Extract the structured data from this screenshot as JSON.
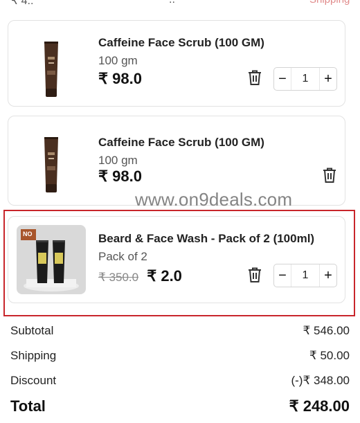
{
  "topbar": {
    "left": "₹ 4..",
    "mid": "..",
    "right": "Shipping"
  },
  "items": [
    {
      "name": "Caffeine Face Scrub (100 GM)",
      "variant": "100 gm",
      "price": "₹ 98.0",
      "quantity": "1",
      "image": "brown-tube-icon"
    },
    {
      "name": "Caffeine Face Scrub (100 GM)",
      "variant": "100 gm",
      "price": "₹ 98.0",
      "image": "brown-tube-icon"
    },
    {
      "name": "Beard & Face Wash - Pack of 2 (100ml)",
      "variant": "Pack of 2",
      "old_price": "₹ 350.0",
      "price": "₹ 2.0",
      "quantity": "1",
      "image": "black-tubes-pack-icon",
      "badge": "NO"
    }
  ],
  "watermark": "www.on9deals.com",
  "summary": {
    "subtotal_label": "Subtotal",
    "subtotal_value": "₹ 546.00",
    "shipping_label": "Shipping",
    "shipping_value": "₹ 50.00",
    "discount_label": "Discount",
    "discount_value": "(-)₹ 348.00",
    "total_label": "Total",
    "total_value": "₹ 248.00"
  },
  "colors": {
    "highlight": "#c8252b",
    "tube_brown": "#4a2f20"
  }
}
